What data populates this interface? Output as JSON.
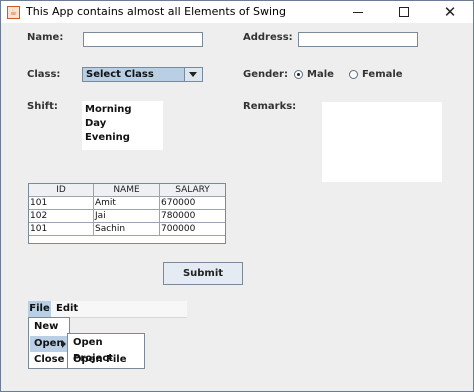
{
  "window": {
    "title": "This App contains almost all Elements of Swing",
    "app_icon": "java-cup-icon"
  },
  "form": {
    "name_label": "Name:",
    "name_value": "",
    "address_label": "Address:",
    "address_value": "",
    "class_label": "Class:",
    "class_selected": "Select Class",
    "gender_label": "Gender:",
    "gender_options": [
      "Male",
      "Female"
    ],
    "gender_selected": "Male",
    "shift_label": "Shift:",
    "shift_items": [
      "Morning",
      "Day",
      "Evening"
    ],
    "remarks_label": "Remarks:",
    "remarks_value": ""
  },
  "table": {
    "columns": [
      "ID",
      "NAME",
      "SALARY"
    ],
    "rows": [
      [
        "101",
        "Amit",
        "670000"
      ],
      [
        "102",
        "Jai",
        "780000"
      ],
      [
        "101",
        "Sachin",
        "700000"
      ]
    ]
  },
  "submit_label": "Submit",
  "menu": {
    "items": [
      "File",
      "Edit"
    ],
    "file_items": [
      "New",
      "Open",
      "Close"
    ],
    "open_submenu": [
      "Open Project",
      "Open File"
    ]
  },
  "colors": {
    "selection": "#b8cfe5",
    "background": "#eeeeee",
    "border": "#7a8a99"
  }
}
